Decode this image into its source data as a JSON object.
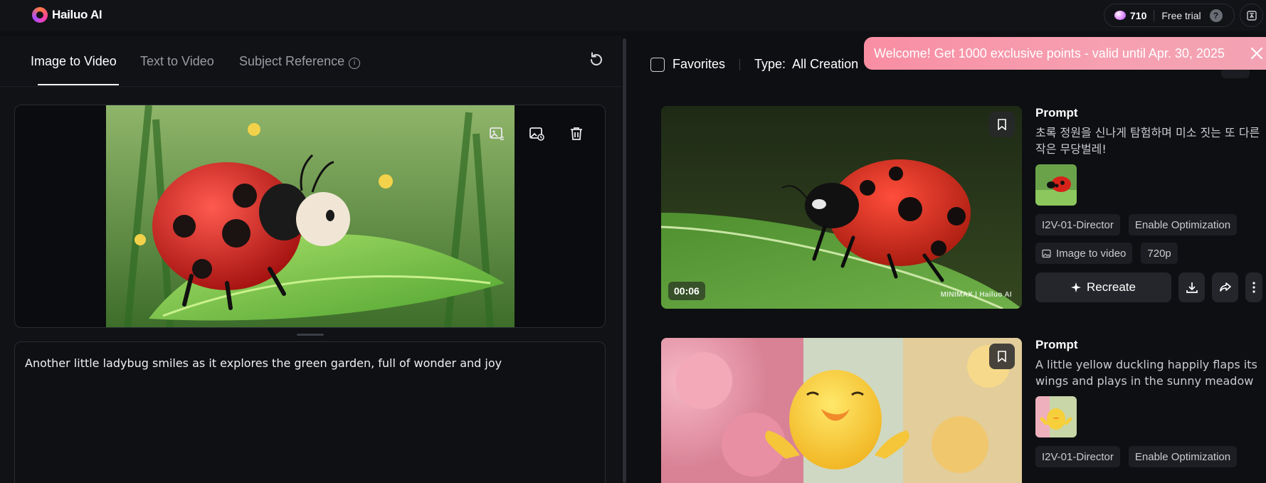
{
  "header": {
    "logo_text": "Hailuo AI",
    "points": "710",
    "plan": "Free trial",
    "help_glyph": "?"
  },
  "left_panel": {
    "tabs": [
      {
        "label": "Image to Video",
        "active": true
      },
      {
        "label": "Text to Video",
        "active": false
      },
      {
        "label": "Subject Reference",
        "active": false
      }
    ],
    "info_glyph": "i",
    "prompt": "Another little ladybug smiles as it explores the green garden, full of wonder and joy"
  },
  "right_panel": {
    "favorites_label": "Favorites",
    "type_label": "Type:",
    "type_value": "All Creation",
    "banner_text": "Welcome! Get 1000 exclusive points - valid until Apr. 30, 2025",
    "cards": [
      {
        "title": "Prompt",
        "prompt": "초록 정원을 신나게 탐험하며 미소 짓는 또 다른 작은 무당벌레!",
        "duration": "00:06",
        "watermark": "MINIMAX | Hailuo AI",
        "chips_row1": [
          "I2V-01-Director",
          "Enable Optimization"
        ],
        "chips_row2": [
          "Image to video",
          "720p"
        ],
        "recreate_label": "Recreate"
      },
      {
        "title": "Prompt",
        "prompt": "A little yellow duckling happily flaps its wings and plays in the sunny meadow",
        "chips_row1": [
          "I2V-01-Director",
          "Enable Optimization"
        ]
      }
    ]
  },
  "colors": {
    "background": "#0e0f12",
    "panel": "#111216",
    "banner": "#f98ea3",
    "chip": "#1d1e23"
  }
}
